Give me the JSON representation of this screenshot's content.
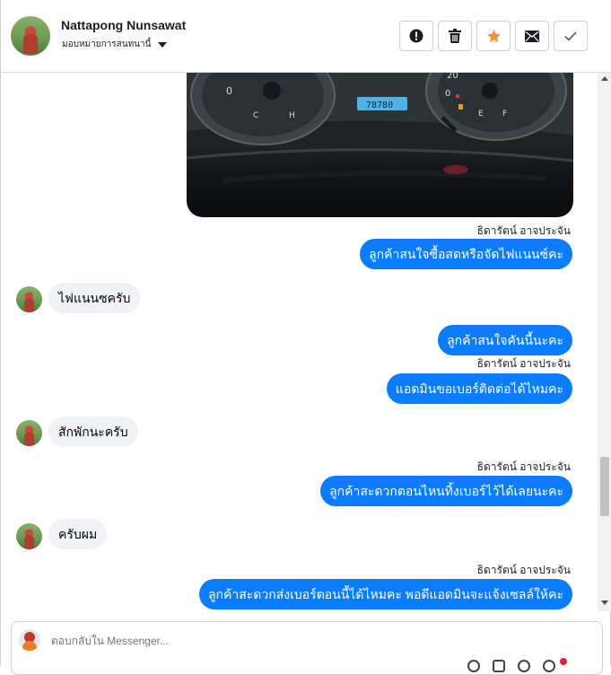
{
  "header": {
    "name": "Nattapong Nunsawat",
    "assign_label": "มอบหมายการสนทนานี้",
    "actions": [
      "report-icon",
      "trash-icon",
      "star-icon",
      "mail-icon",
      "check-icon"
    ],
    "colors": {
      "star": "#f7923b",
      "icon": "#1c1e21"
    }
  },
  "photo": {
    "odometer": "78780"
  },
  "messages": [
    {
      "sender": "ธิดารัตน์ อาจประจัน",
      "text": "ลูกค้าสนใจซื้อสดหรือจัดไฟแนนซ์คะ",
      "direction": "out"
    },
    {
      "text": "ไฟแนนซครับ",
      "direction": "in"
    },
    {
      "text": "ลูกค้าสนใจคันนี้นะคะ",
      "direction": "out"
    },
    {
      "sender": "ธิดารัตน์ อาจประจัน",
      "text": "แอดมินขอเบอร์ติดต่อได้ไหมคะ",
      "direction": "out"
    },
    {
      "text": "สักพักนะครับ",
      "direction": "in"
    },
    {
      "sender": "ธิดารัตน์ อาจประจัน",
      "text": "ลูกค้าสะดวกตอนไหนทิ้งเบอร์ไว้ได้เลยนะคะ",
      "direction": "out"
    },
    {
      "text": "ครับผม",
      "direction": "in"
    },
    {
      "sender": "ธิดารัตน์ อาจประจัน",
      "text": "ลูกค้าสะดวกส่งเบอร์ตอนนี้ได้ไหมคะ พอดีแอดมินจะแจ้งเซลล์ให้คะ",
      "direction": "out"
    }
  ],
  "composer": {
    "placeholder": "ตอบกลับใน Messenger..."
  },
  "colors": {
    "bubble_out": "#0a7cff",
    "bubble_in": "#f0f2f5"
  }
}
